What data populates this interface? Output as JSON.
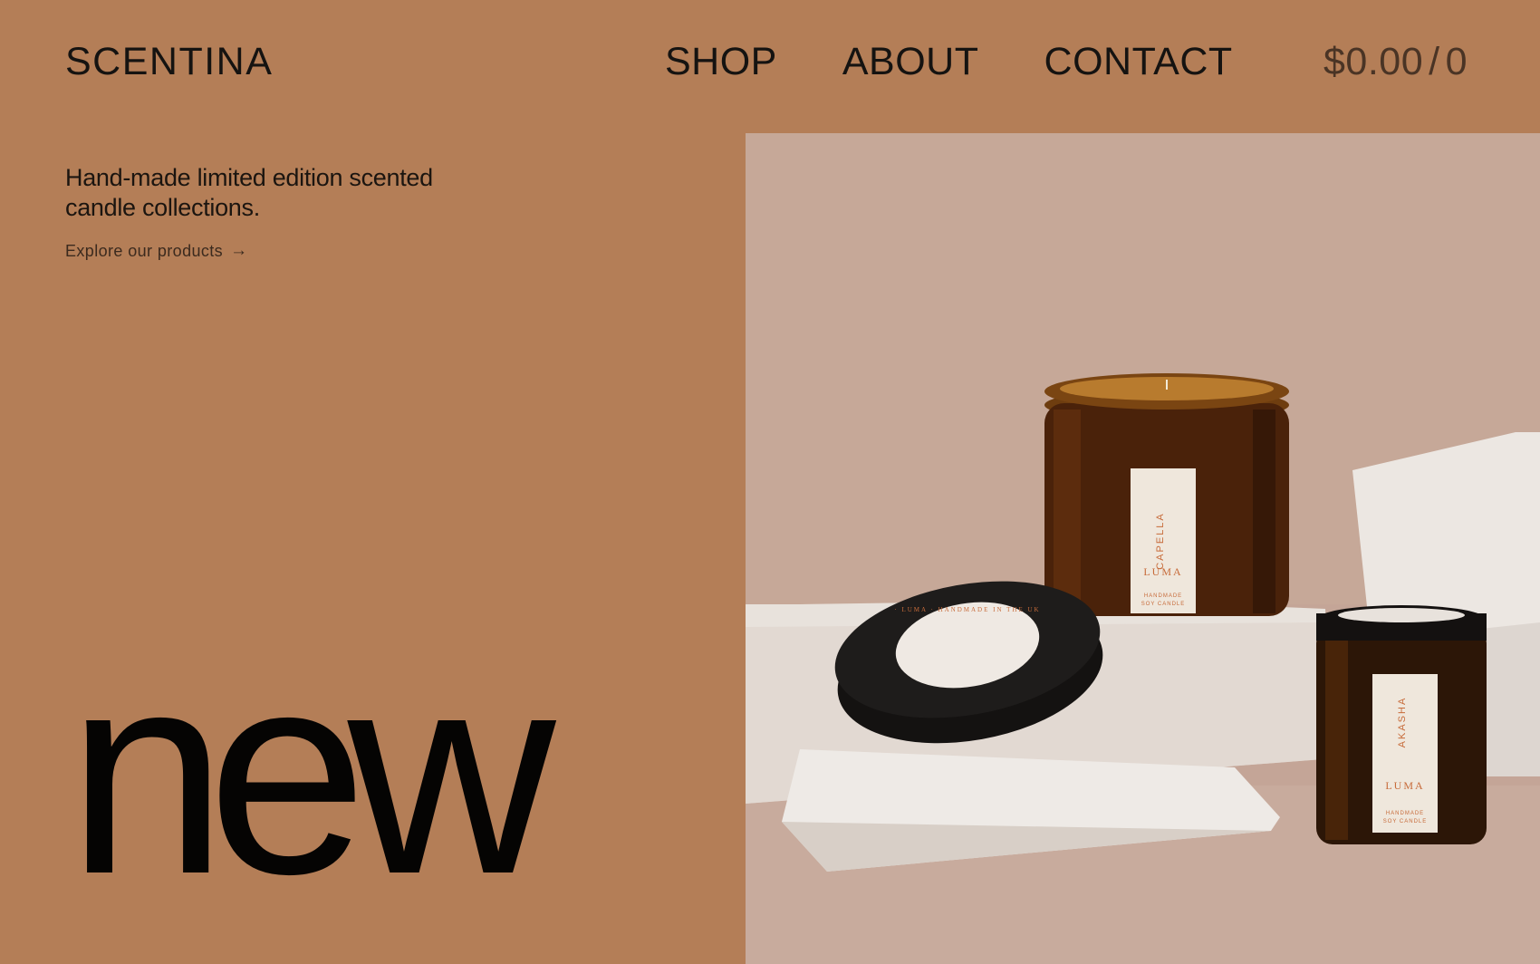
{
  "header": {
    "brand": "SCENTINA",
    "nav": [
      {
        "label": "SHOP"
      },
      {
        "label": "ABOUT"
      },
      {
        "label": "CONTACT"
      }
    ],
    "cart": {
      "amount": "$0.00",
      "separator": "/",
      "count": "0"
    }
  },
  "hero": {
    "tagline": "Hand-made limited edition scented candle collections.",
    "cta_label": "Explore our products",
    "cta_icon": "arrow-right-icon",
    "big_word": "new"
  },
  "product_image": {
    "large_jar_name": "CAPELLA",
    "small_jar_name": "AKASHA",
    "label_brand": "LUMA",
    "label_line_1": "HANDMADE",
    "label_line_2": "SOY CANDLE",
    "lid_text": "· LUMA · HANDMADE IN THE UK"
  },
  "colors": {
    "background": "#b47e57",
    "text": "#151311",
    "photo_backdrop": "#c8aa9a"
  }
}
